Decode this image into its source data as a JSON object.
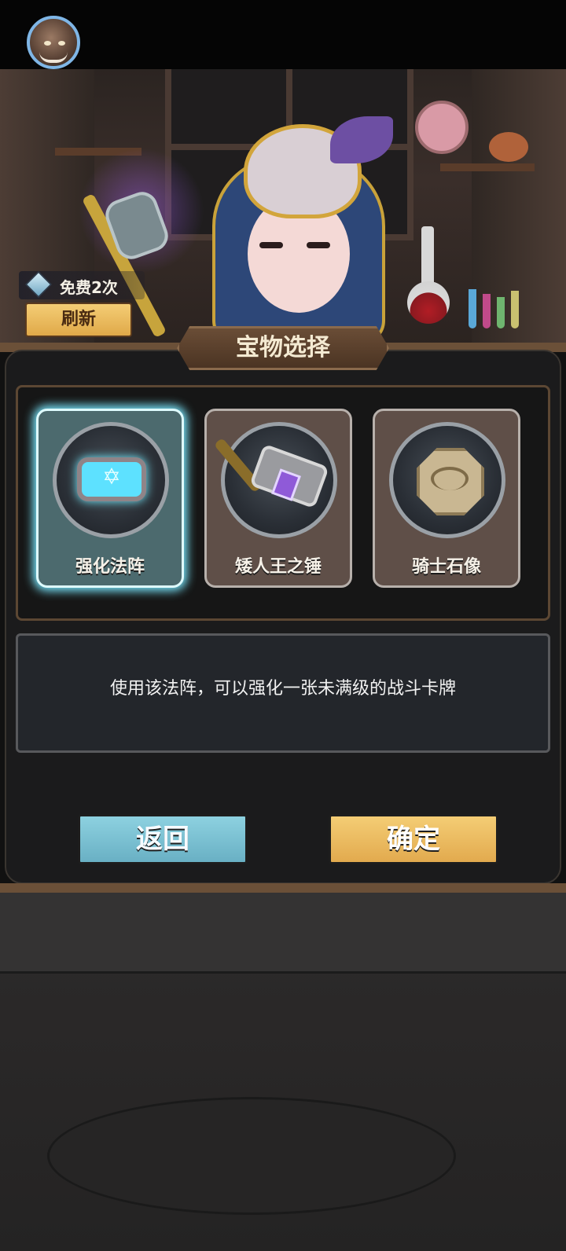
{
  "header": {
    "free_refresh_text": "免费2次",
    "refresh_label": "刷新"
  },
  "panel": {
    "title": "宝物选择",
    "items": [
      {
        "label": "强化法阵",
        "icon": "rune-circle-icon",
        "selected": true
      },
      {
        "label": "矮人王之锤",
        "icon": "hammer-icon",
        "selected": false
      },
      {
        "label": "骑士石像",
        "icon": "stone-statue-icon",
        "selected": false
      }
    ],
    "description": "使用该法阵，可以强化一张未满级的战斗卡牌",
    "buttons": {
      "back_label": "返回",
      "confirm_label": "确定"
    }
  },
  "colors": {
    "accent_gold": "#e0a949",
    "accent_blue": "#69b0c4",
    "selected_glow": "#7be9ff"
  }
}
